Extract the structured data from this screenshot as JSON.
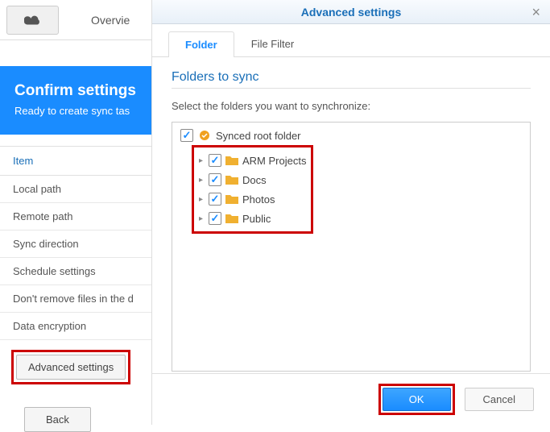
{
  "topbar": {
    "overview": "Overvie"
  },
  "header": {
    "title": "Confirm settings",
    "subtitle": "Ready to create sync tas"
  },
  "settings": {
    "header": "Item",
    "rows": [
      "Local path",
      "Remote path",
      "Sync direction",
      "Schedule settings",
      "Don't remove files in the d",
      "Data encryption"
    ],
    "advanced_btn": "Advanced settings",
    "back_btn": "Back"
  },
  "modal": {
    "title": "Advanced settings",
    "tabs": {
      "folder": "Folder",
      "filter": "File Filter"
    },
    "section_title": "Folders to sync",
    "instruction": "Select the folders you want to synchronize:",
    "root": "Synced root folder",
    "children": [
      "ARM Projects",
      "Docs",
      "Photos",
      "Public"
    ],
    "ok": "OK",
    "cancel": "Cancel"
  }
}
